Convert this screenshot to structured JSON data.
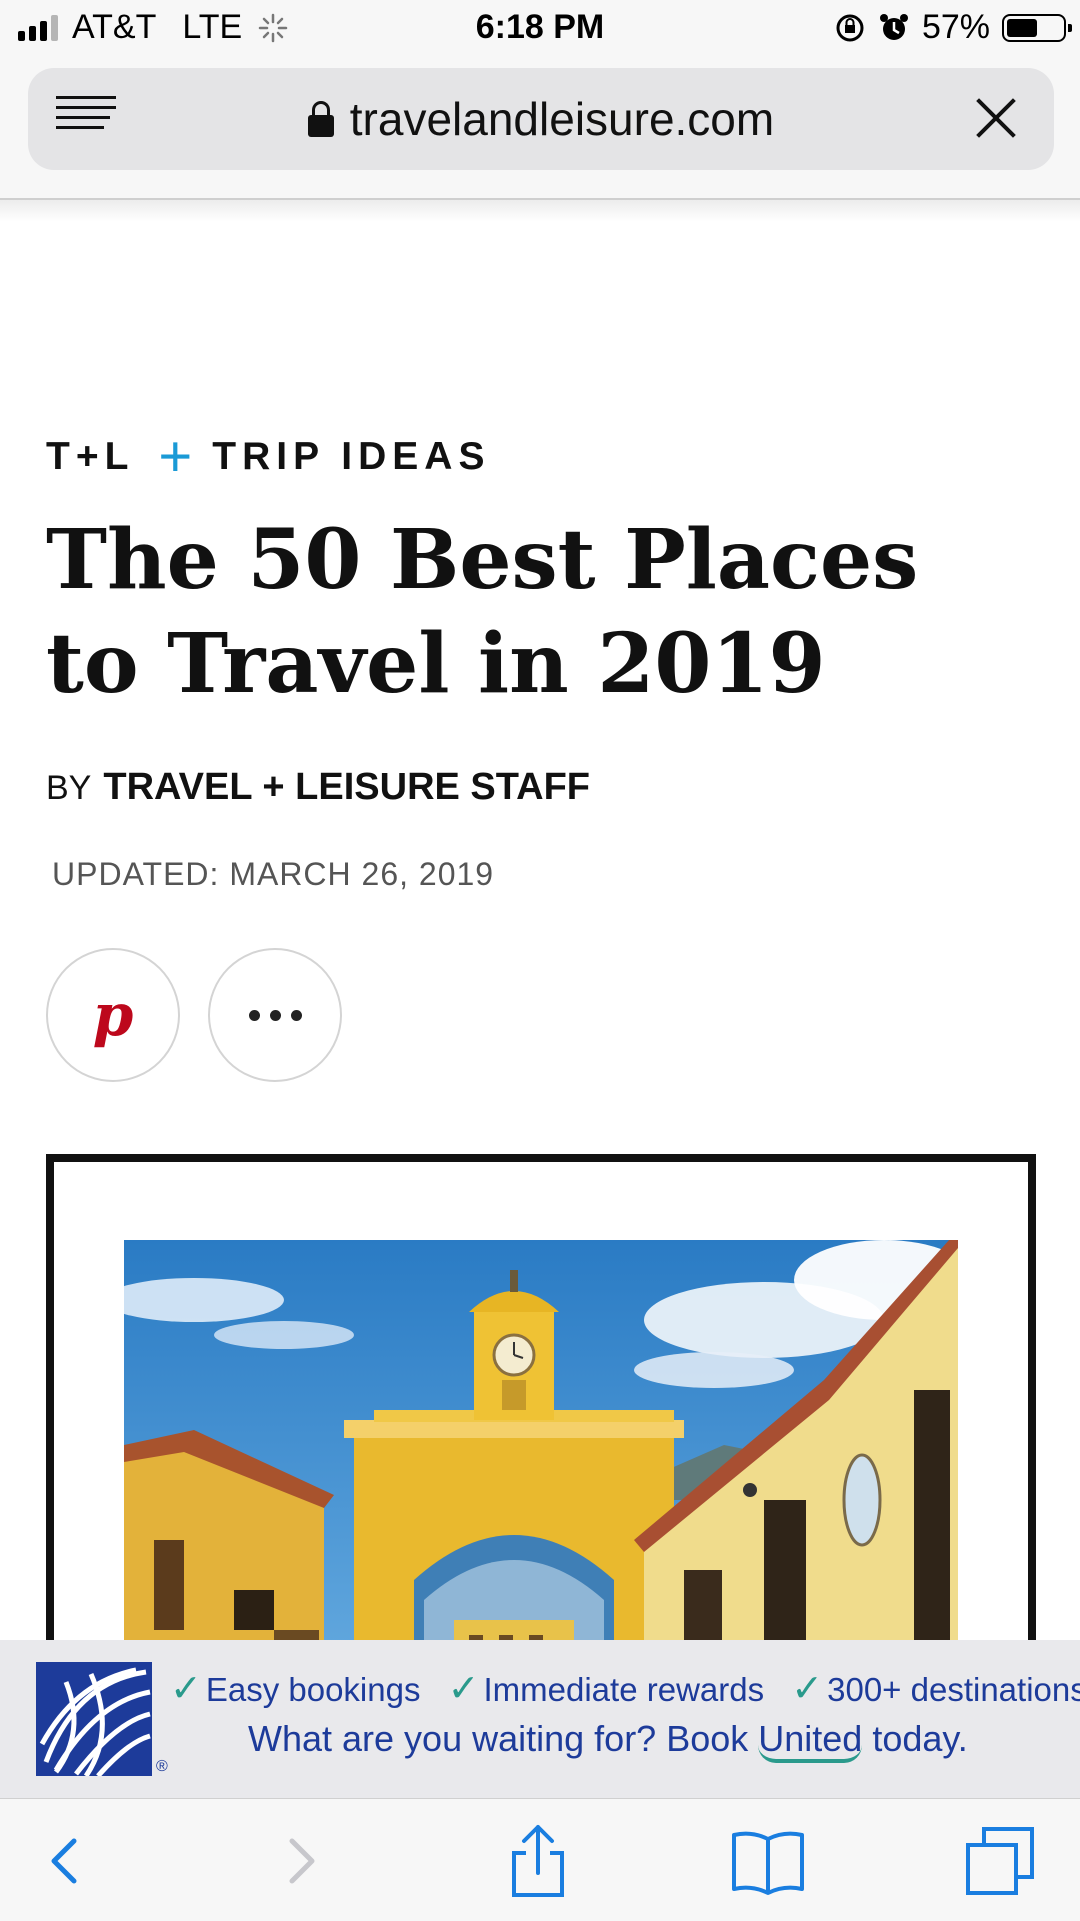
{
  "status_bar": {
    "carrier": "AT&T",
    "network": "LTE",
    "time": "6:18 PM",
    "battery_percent": "57%",
    "battery_level": 0.57
  },
  "browser": {
    "url": "travelandleisure.com"
  },
  "article": {
    "kicker_brand": "T+L",
    "kicker_plus": "+",
    "kicker_section": "TRIP IDEAS",
    "title": "The 50 Best Places to Travel in 2019",
    "byline_prefix": "BY",
    "author": "TRAVEL + LEISURE STAFF",
    "updated": "UPDATED: MARCH 26, 2019"
  },
  "ad": {
    "items": [
      "Easy bookings",
      "Immediate rewards",
      "300+ destinations"
    ],
    "cta_before": "What are you waiting for? Book ",
    "cta_brand": "United",
    "cta_after": " today.",
    "registered": "®"
  },
  "icons": {
    "menu": "menu-icon",
    "lock": "lock-icon",
    "close": "close-icon",
    "pinterest": "pinterest-icon",
    "more": "more-icon",
    "back": "back-icon",
    "forward": "forward-icon",
    "share": "share-icon",
    "bookmarks": "bookmarks-icon",
    "tabs": "tabs-icon"
  },
  "colors": {
    "accent_blue": "#1a9ad6",
    "pinterest_red": "#bd081c",
    "united_blue": "#1d3b9a",
    "check_teal": "#2a9a8c",
    "ios_blue": "#1a7ee0"
  }
}
